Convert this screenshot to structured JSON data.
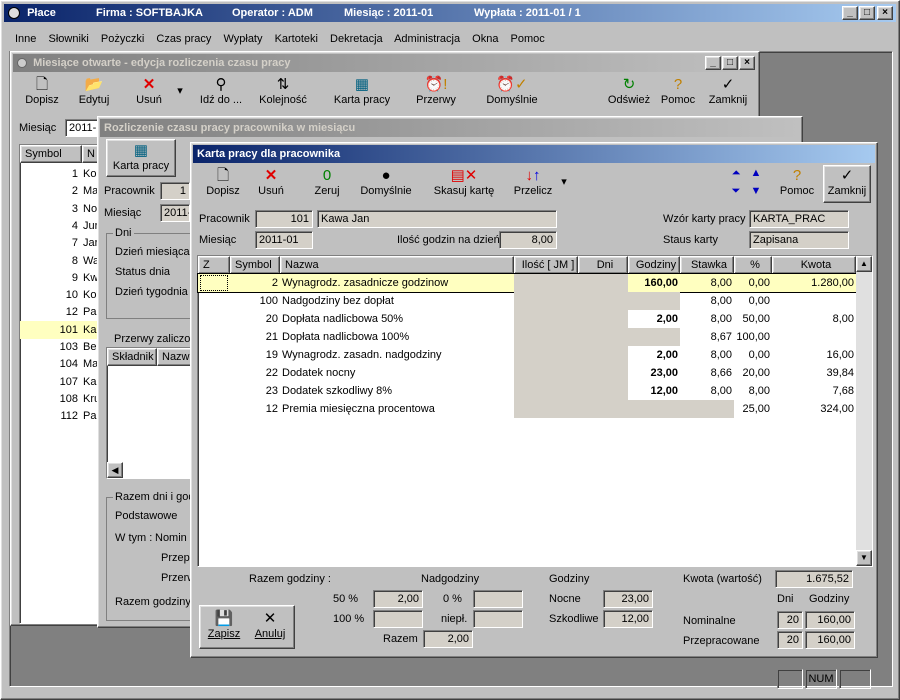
{
  "app": {
    "title": "Płace",
    "firma": "Firma : SOFTBAJKA",
    "operator": "Operator : ADM",
    "miesiac": "Miesiąc : 2011-01",
    "wyplata": "Wypłata : 2011-01 /  1"
  },
  "menu": [
    "Inne",
    "Słowniki",
    "Pożyczki",
    "Czas pracy",
    "Wypłaty",
    "Kartoteki",
    "Dekretacja",
    "Administracja",
    "Okna",
    "Pomoc"
  ],
  "win1": {
    "title": "Miesiące otwarte - edycja rozliczenia czasu pracy",
    "buttons": [
      "Dopisz",
      "Edytuj",
      "Usuń",
      "Idź do ...",
      "Kolejność",
      "Karta pracy",
      "Przerwy",
      "Domyślnie",
      "Odśwież",
      "Pomoc",
      "Zamknij"
    ],
    "miesiac_label": "Miesiąc",
    "miesiac_value": "2011-",
    "col_symbol": "Symbol",
    "col_n": "N",
    "rows": [
      {
        "num": "1",
        "name": "Ko"
      },
      {
        "num": "2",
        "name": "Ma"
      },
      {
        "num": "3",
        "name": "No"
      },
      {
        "num": "4",
        "name": "Jur"
      },
      {
        "num": "7",
        "name": "Jar"
      },
      {
        "num": "8",
        "name": "Wa"
      },
      {
        "num": "9",
        "name": "Kw"
      },
      {
        "num": "10",
        "name": "Ko"
      },
      {
        "num": "12",
        "name": "Pa"
      },
      {
        "num": "101",
        "name": "Ka"
      },
      {
        "num": "103",
        "name": "Be"
      },
      {
        "num": "104",
        "name": "Ma"
      },
      {
        "num": "107",
        "name": "Ka"
      },
      {
        "num": "108",
        "name": "Kru"
      },
      {
        "num": "112",
        "name": "Pa"
      }
    ]
  },
  "win2": {
    "title": "Rozliczenie czasu pracy pracownika w miesiącu",
    "karta_pracy": "Karta pracy",
    "pracownik": "Pracownik",
    "pracownik_val": "1",
    "miesiac": "Miesiąc",
    "miesiac_val": "2011-",
    "dni": "Dni",
    "dzien_miesiaca": "Dzień miesiąca",
    "status_dnia": "Status dnia",
    "dzien_tygodnia": "Dzień tygodnia",
    "przerwy": "Przerwy zaliczon",
    "skladnik": "Składnik",
    "nazwa": "Nazwa",
    "razem_dni": "Razem dni i god",
    "podstawowe": "Podstawowe",
    "w_tym": "W tym :",
    "nomin": "Nomin",
    "przepr": "Przepr",
    "przerw": "Przerw",
    "razem_godziny": "Razem godziny"
  },
  "win3": {
    "title": "Karta pracy dla pracownika",
    "buttons": [
      "Dopisz",
      "Usuń",
      "Zeruj",
      "Domyślnie",
      "Skasuj kartę",
      "Przelicz",
      "Pomoc",
      "Zamknij"
    ],
    "pracownik_label": "Pracownik",
    "pracownik_num": "101",
    "pracownik_name": "Kawa Jan",
    "miesiac_label": "Miesiąc",
    "miesiac_val": "2011-01",
    "ilosc_label": "Ilość godzin na dzień",
    "ilosc_val": "8,00",
    "wzor_label": "Wzór karty pracy",
    "wzor_val": "KARTA_PRAC",
    "status_label": "Staus karty",
    "status_val": "Zapisana",
    "columns": [
      "Z",
      "Symbol",
      "Nazwa",
      "Ilość [ JM ]",
      "Dni",
      "Godziny",
      "Stawka",
      "%",
      "Kwota"
    ],
    "rows": [
      {
        "symbol": "2",
        "nazwa": "Wynagrodz. zasadnicze godzinow",
        "godziny": "160,00",
        "stawka": "8,00",
        "proc": "0,00",
        "kwota": "1.280,00"
      },
      {
        "symbol": "100",
        "nazwa": "Nadgodziny bez dopłat",
        "godziny": "",
        "stawka": "8,00",
        "proc": "0,00",
        "kwota": ""
      },
      {
        "symbol": "20",
        "nazwa": "Dopłata nadlicbowa 50%",
        "godziny": "2,00",
        "stawka": "8,00",
        "proc": "50,00",
        "kwota": "8,00"
      },
      {
        "symbol": "21",
        "nazwa": "Dopłata nadlicbowa 100%",
        "godziny": "",
        "stawka": "8,67",
        "proc": "100,00",
        "kwota": ""
      },
      {
        "symbol": "19",
        "nazwa": "Wynagrodz. zasadn. nadgodziny",
        "godziny": "2,00",
        "stawka": "8,00",
        "proc": "0,00",
        "kwota": "16,00"
      },
      {
        "symbol": "22",
        "nazwa": "Dodatek nocny",
        "godziny": "23,00",
        "stawka": "8,66",
        "proc": "20,00",
        "kwota": "39,84"
      },
      {
        "symbol": "23",
        "nazwa": "Dodatek szkodliwy 8%",
        "godziny": "12,00",
        "stawka": "8,00",
        "proc": "8,00",
        "kwota": "7,68"
      },
      {
        "symbol": "12",
        "nazwa": "Premia miesięczna procentowa",
        "godziny": "",
        "stawka": "",
        "proc": "25,00",
        "kwota": "324,00"
      }
    ],
    "footer": {
      "razem_godziny": "Razem godziny :",
      "nadgodziny": "Nadgodziny",
      "p50": "50 %",
      "p50_val": "2,00",
      "p0": "0 %",
      "p100": "100 %",
      "niepl": "niepł.",
      "razem": "Razem",
      "razem_val": "2,00",
      "godziny": "Godziny",
      "nocne": "Nocne",
      "nocne_val": "23,00",
      "szkodliwe": "Szkodliwe",
      "szkodliwe_val": "12,00",
      "kwota_label": "Kwota (wartość)",
      "kwota_val": "1.675,52",
      "dni": "Dni",
      "godziny2": "Godziny",
      "nominalne": "Nominalne",
      "nom_dni": "20",
      "nom_godz": "160,00",
      "przepracowane": "Przepracowane",
      "prz_dni": "20",
      "prz_godz": "160,00",
      "zapisz": "Zapisz",
      "anuluj": "Anuluj"
    }
  },
  "statusbar": {
    "num": "NUM"
  }
}
